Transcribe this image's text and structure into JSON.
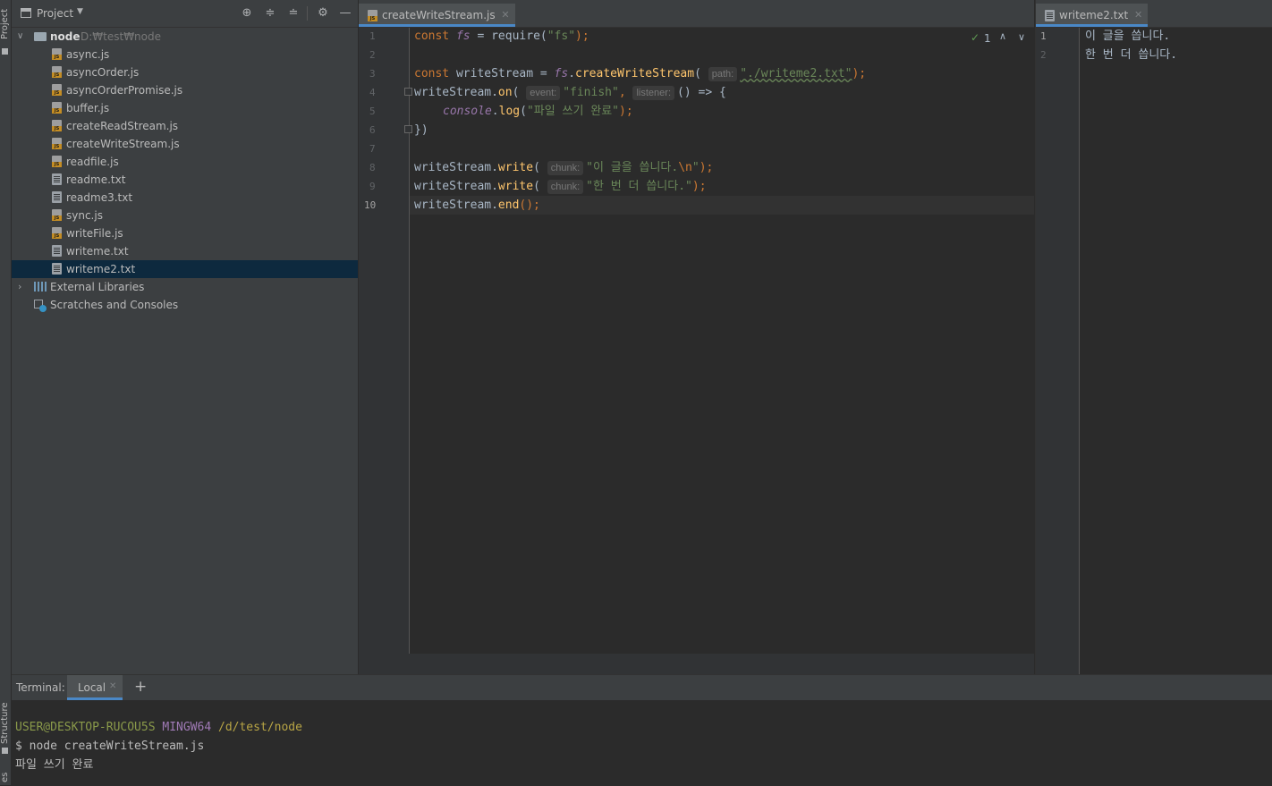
{
  "side_tabs": {
    "project": "Project",
    "structure": "Structure",
    "bottom": "es"
  },
  "project_panel": {
    "title": "Project",
    "root": {
      "name": "node",
      "path": "D:₩test₩node"
    },
    "files": [
      {
        "name": "async.js",
        "type": "js"
      },
      {
        "name": "asyncOrder.js",
        "type": "js"
      },
      {
        "name": "asyncOrderPromise.js",
        "type": "js"
      },
      {
        "name": "buffer.js",
        "type": "js"
      },
      {
        "name": "createReadStream.js",
        "type": "js"
      },
      {
        "name": "createWriteStream.js",
        "type": "js"
      },
      {
        "name": "readfile.js",
        "type": "js"
      },
      {
        "name": "readme.txt",
        "type": "txt"
      },
      {
        "name": "readme3.txt",
        "type": "txt"
      },
      {
        "name": "sync.js",
        "type": "js"
      },
      {
        "name": "writeFile.js",
        "type": "js"
      },
      {
        "name": "writeme.txt",
        "type": "txt"
      },
      {
        "name": "writeme2.txt",
        "type": "txt",
        "selected": true
      }
    ],
    "external_libraries": "External Libraries",
    "scratches": "Scratches and Consoles"
  },
  "editor_left": {
    "tab": "createWriteStream.js",
    "inspection_count": "1",
    "line_numbers": [
      "1",
      "2",
      "3",
      "4",
      "5",
      "6",
      "7",
      "8",
      "9",
      "10"
    ],
    "current_line": 10,
    "code": {
      "l1": {
        "const": "const",
        "fs": "fs",
        "eq": " = ",
        "require": "require(",
        "arg": "\"fs\"",
        "end": ");"
      },
      "l3": {
        "const": "const",
        "name": " writeStream = ",
        "fs": "fs",
        "dot": ".",
        "fn": "createWriteStream",
        "paren": "(",
        "hint": "path:",
        "arg": "\"./writeme2.txt\"",
        "end": ");"
      },
      "l4": {
        "obj": "writeStream.",
        "fn": "on",
        "paren": "(",
        "hint1": "event:",
        "arg1": "\"finish\"",
        "comma": ", ",
        "hint2": "listener:",
        "rest": "() => {"
      },
      "l5": {
        "obj": "console",
        "dot": ".",
        "fn": "log",
        "paren": "(",
        "arg": "\"파일 쓰기 완료\"",
        "end": ");"
      },
      "l6": {
        "text": "})"
      },
      "l8": {
        "obj": "writeStream.",
        "fn": "write",
        "paren": "(",
        "hint": "chunk:",
        "arg": "\"이 글을 씁니다.",
        "esc": "\\n",
        "quote": "\"",
        "end": ");"
      },
      "l9": {
        "obj": "writeStream.",
        "fn": "write",
        "paren": "(",
        "hint": "chunk:",
        "arg": "\"한 번 더 씁니다.\"",
        "end": ");"
      },
      "l10": {
        "obj": "writeStream.",
        "fn": "end",
        "end": "();"
      }
    }
  },
  "editor_right": {
    "tab": "writeme2.txt",
    "line_numbers": [
      "1",
      "2"
    ],
    "lines": [
      "이 글을 씁니다.",
      "한 번 더 씁니다."
    ]
  },
  "terminal": {
    "label": "Terminal:",
    "tab": "Local",
    "add": "+",
    "prompt_user": "USER@DESKTOP-RUCOU5S",
    "prompt_env": "MINGW64",
    "prompt_path": "/d/test/node",
    "command": "$ node createWriteStream.js",
    "output": "파일 쓰기 완료"
  },
  "colors": {
    "accent": "#4a88c7",
    "background": "#2b2b2b",
    "panel": "#3c3f41",
    "selection": "#0d293e",
    "prompt_user": "#8a9a4a",
    "prompt_env": "#a07ab6",
    "prompt_path": "#b8a545"
  }
}
